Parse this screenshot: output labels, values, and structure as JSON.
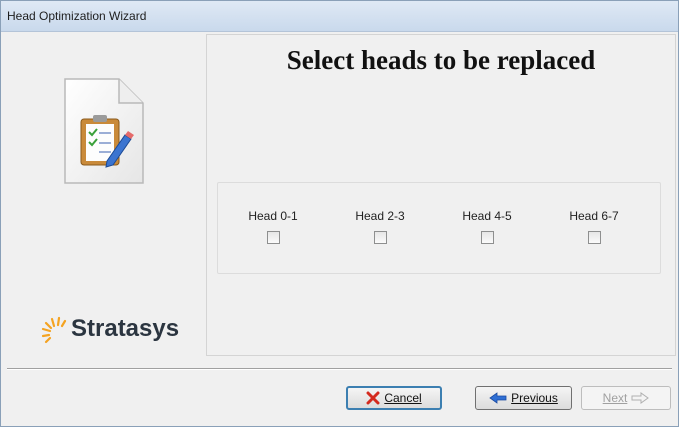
{
  "window": {
    "title": "Head Optimization Wizard"
  },
  "left_panel": {
    "logo_text": "Stratasys",
    "document_icon": "clipboard-doc-icon"
  },
  "main": {
    "heading": "Select heads to be replaced",
    "heads": [
      {
        "label": "Head 0-1",
        "checked": false
      },
      {
        "label": "Head 2-3",
        "checked": false
      },
      {
        "label": "Head 4-5",
        "checked": false
      },
      {
        "label": "Head 6-7",
        "checked": false
      }
    ]
  },
  "buttons": {
    "cancel": {
      "label": "Cancel",
      "icon": "red-x-icon"
    },
    "previous": {
      "label": "Previous",
      "icon": "blue-left-arrow-icon"
    },
    "next": {
      "label": "Next",
      "icon": "right-arrow-outline-icon",
      "disabled": true
    }
  },
  "colors": {
    "accent": "#3c7fb1",
    "logo_orange": "#f4a321"
  }
}
